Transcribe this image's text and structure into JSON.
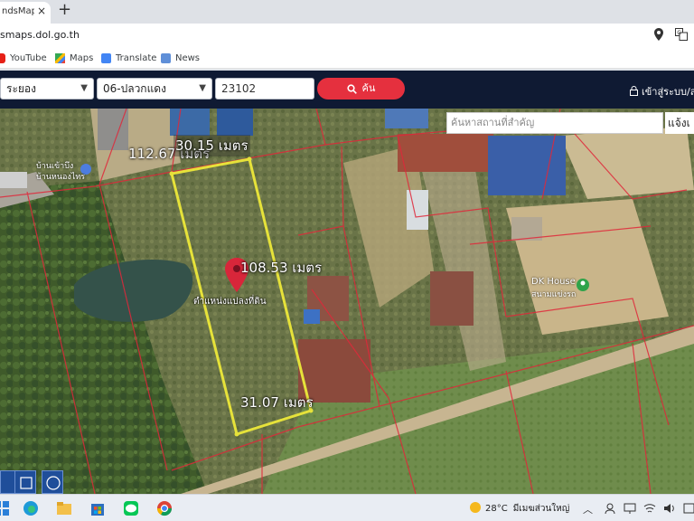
{
  "browser": {
    "tab_title": "ndsMaps",
    "tab_close": "×",
    "new_tab": "+",
    "url": "smaps.dol.go.th",
    "bookmarks": [
      {
        "label": "YouTube",
        "icon": "youtube-icon"
      },
      {
        "label": "Maps",
        "icon": "maps-icon"
      },
      {
        "label": "Translate",
        "icon": "translate-icon"
      },
      {
        "label": "News",
        "icon": "news-icon"
      }
    ]
  },
  "header": {
    "province": "ระยอง",
    "district": "06-ปลวกแดง",
    "postal_code": "23102",
    "search_label": "ค้น",
    "login_label": "เข้าสู่ระบบ/ล"
  },
  "map": {
    "place_search_placeholder": "ค้นหาสถานที่สำคัญ",
    "notify_label": "แจ้งเ",
    "dimensions": {
      "top_left": "112.67 เมตร",
      "top": "30.15 เมตร",
      "right": "108.53 เมตร",
      "bottom": "31.07 เมตร"
    },
    "marker_label": "ตำแหน่งแปลงที่ดิน",
    "poi": {
      "shop": "DK House",
      "shop_sub": "สนามแข่งรถ",
      "village": "บ้านเข้าบึง",
      "village_sub": "บ้านหนองไทร"
    },
    "parcel_color": "#e6e23a",
    "boundary_color": "#e0283a"
  },
  "taskbar": {
    "temperature": "28°C",
    "weather": "มีเมฆส่วนใหญ่",
    "apps": [
      "start-icon",
      "edge-icon",
      "file-explorer-icon",
      "store-icon",
      "line-icon",
      "chrome-icon"
    ]
  }
}
